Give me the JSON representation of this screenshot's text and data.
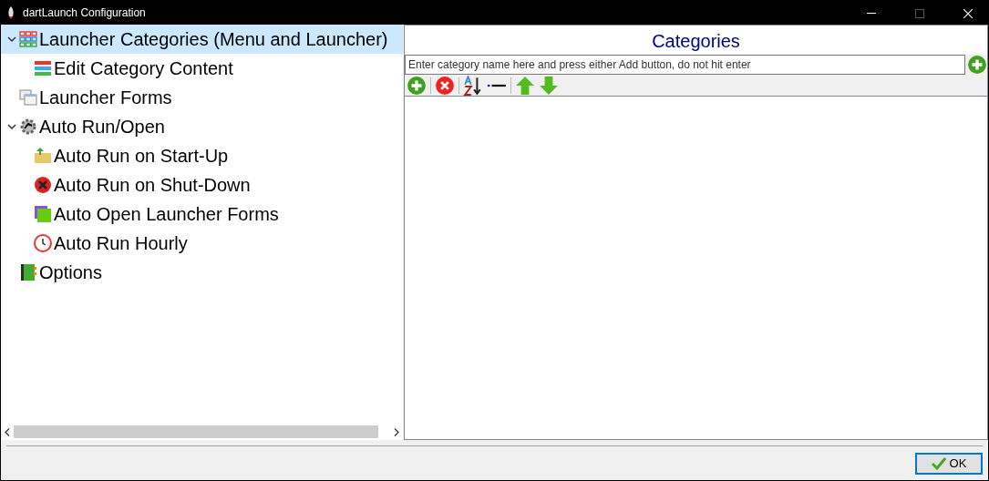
{
  "window": {
    "title": "dartLaunch Configuration"
  },
  "tree": [
    {
      "label": "Launcher Categories (Menu and Launcher)",
      "selected": true,
      "expanded": true,
      "children": [
        {
          "label": "Edit Category Content",
          "selected": false
        }
      ]
    },
    {
      "label": "Launcher Forms",
      "selected": false
    },
    {
      "label": "Auto Run/Open",
      "selected": false,
      "expanded": true,
      "children": [
        {
          "label": "Auto Run on Start-Up",
          "selected": false
        },
        {
          "label": "Auto Run on Shut-Down",
          "selected": false
        },
        {
          "label": "Auto Open Launcher Forms",
          "selected": false
        },
        {
          "label": "Auto Run Hourly",
          "selected": false
        }
      ]
    },
    {
      "label": "Options",
      "selected": false
    }
  ],
  "panel": {
    "title": "Categories",
    "input": {
      "placeholder": "Enter category name here and press either Add button, do not hit enter"
    }
  },
  "buttons": [
    {
      "label": "OK"
    }
  ]
}
